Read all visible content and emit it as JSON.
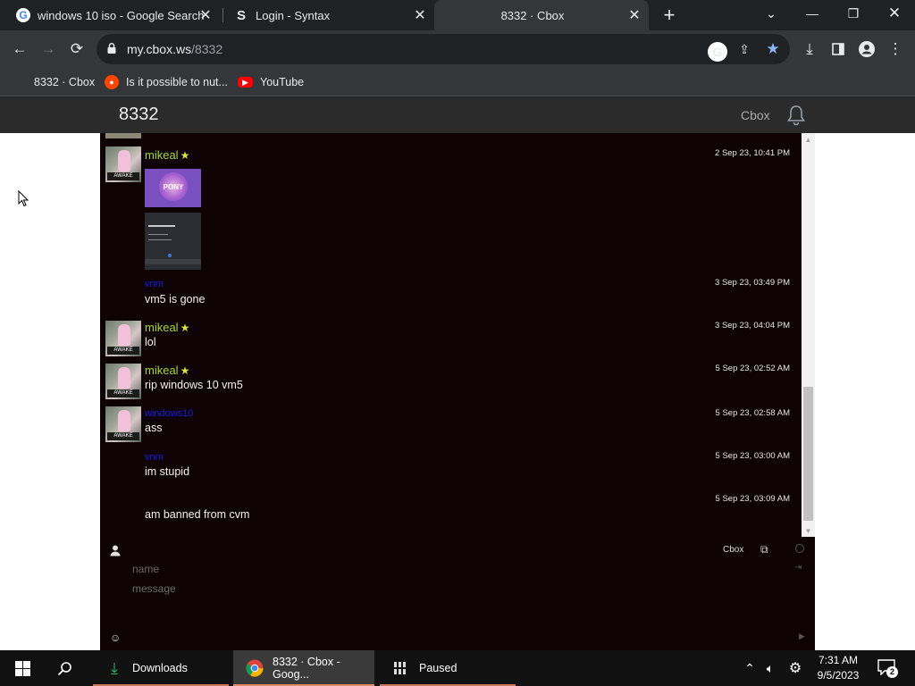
{
  "browser": {
    "tabs": [
      {
        "title": "windows 10 iso - Google Search",
        "icon": "google-icon"
      },
      {
        "title": "Login - Syntax",
        "icon": "syntax-s-icon"
      },
      {
        "title": "8332 · Cbox",
        "icon": "none",
        "active": true
      }
    ],
    "url_host": "my.cbox.ws",
    "url_path": "/8332",
    "bookmarks": [
      {
        "label": "8332 · Cbox"
      },
      {
        "label": "Is it possible to nut...",
        "icon": "reddit-icon"
      },
      {
        "label": "YouTube",
        "icon": "youtube-icon"
      }
    ]
  },
  "site": {
    "title": "8332",
    "brand": "Cbox"
  },
  "messages": [
    {
      "name": "mikeal",
      "star": true,
      "time": "2 Sep 23, 10:41 PM",
      "has_images": true
    },
    {
      "name": "vnm",
      "time": "3 Sep 23, 03:49 PM",
      "text": "vm5 is gone"
    },
    {
      "name": "mikeal",
      "star": true,
      "time": "3 Sep 23, 04:04 PM",
      "text": "lol"
    },
    {
      "name": "mikeal",
      "star": true,
      "time": "5 Sep 23, 02:52 AM",
      "text": "rip windows 10 vm5"
    },
    {
      "name": "windows10",
      "time": "5 Sep 23, 02:58 AM",
      "text": "ass"
    },
    {
      "name": "vnm",
      "time": "5 Sep 23, 03:00 AM",
      "text": "im stupid"
    },
    {
      "time": "5 Sep 23, 03:09 AM",
      "text": "am banned from cvm"
    }
  ],
  "images": {
    "mlp_caption": "PONY",
    "avatar_caption": "AWAKE"
  },
  "form": {
    "brand": "Cbox",
    "name_placeholder": "name",
    "message_placeholder": "message"
  },
  "taskbar": {
    "apps": [
      {
        "label": "Downloads"
      },
      {
        "label": "8332 · Cbox - Goog...",
        "active": true
      },
      {
        "label": "Paused"
      }
    ],
    "time": "7:31 AM",
    "date": "9/5/2023",
    "notification_count": "2"
  },
  "colors": {
    "chat_bg": "#0f0205",
    "name_green": "#a6d831",
    "name_blue": "#1a1ae8",
    "star_yellow": "#d8e633"
  }
}
